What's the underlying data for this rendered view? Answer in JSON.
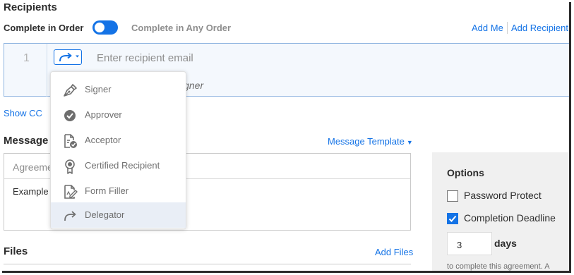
{
  "recipients": {
    "title": "Recipients",
    "order_label": "Complete in Order",
    "order_alt_label": "Complete in Any Order",
    "add_me": "Add Me",
    "add_recipient": "Add Recipient",
    "row_number": "1",
    "email_placeholder": "Enter recipient email",
    "role_hint": "igner",
    "show_cc": "Show CC"
  },
  "role_menu": {
    "items": [
      {
        "label": "Signer",
        "icon": "signer-pen-icon"
      },
      {
        "label": "Approver",
        "icon": "approver-check-icon"
      },
      {
        "label": "Acceptor",
        "icon": "acceptor-doc-icon"
      },
      {
        "label": "Certified Recipient",
        "icon": "certified-ribbon-icon"
      },
      {
        "label": "Form Filler",
        "icon": "form-filler-icon"
      },
      {
        "label": "Delegator",
        "icon": "delegator-arrow-icon"
      }
    ],
    "selected": "Delegator"
  },
  "message": {
    "title": "Message",
    "template_link": "Message Template",
    "agreement_name_placeholder": "Agreeme",
    "body_text": "Example"
  },
  "files": {
    "title": "Files",
    "add_files": "Add Files"
  },
  "options": {
    "title": "Options",
    "password_protect": "Password Protect",
    "password_protect_checked": false,
    "completion_deadline": "Completion Deadline",
    "completion_deadline_checked": true,
    "days_value": "3",
    "days_label": "days",
    "complete_text": "to complete this agreement. A"
  },
  "colors": {
    "accent": "#1473e6",
    "text": "#2c2c2c",
    "muted": "#8e8e8e"
  }
}
